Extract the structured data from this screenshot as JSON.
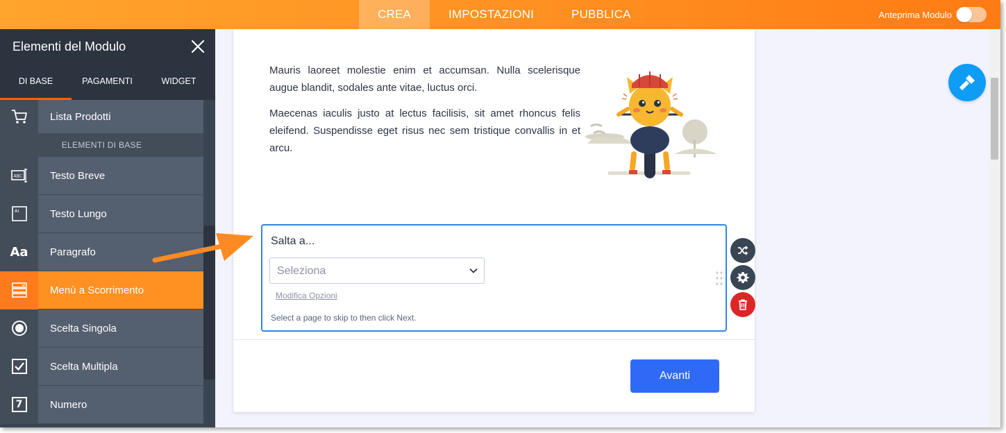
{
  "topbar": {
    "tabs": [
      {
        "label": "CREA",
        "active": true
      },
      {
        "label": "IMPOSTAZIONI",
        "active": false
      },
      {
        "label": "PUBBLICA",
        "active": false
      }
    ],
    "preview_label": "Anteprima Modulo",
    "preview_on": false
  },
  "sidebar": {
    "title": "Elementi del Modulo",
    "tabs": [
      {
        "label": "DI BASE",
        "active": true
      },
      {
        "label": "PAGAMENTI",
        "active": false
      },
      {
        "label": "WIDGET",
        "active": false
      }
    ],
    "top_item": {
      "label": "Lista Prodotti",
      "icon": "cart-icon"
    },
    "section_label": "ELEMENTI DI BASE",
    "items": [
      {
        "label": "Testo Breve",
        "icon": "short-text-icon"
      },
      {
        "label": "Testo Lungo",
        "icon": "long-text-icon"
      },
      {
        "label": "Paragrafo",
        "icon": "paragraph-icon",
        "glyph": "Aa"
      },
      {
        "label": "Menù a Scorrimento",
        "icon": "dropdown-icon",
        "active": true
      },
      {
        "label": "Scelta Singola",
        "icon": "radio-icon"
      },
      {
        "label": "Scelta Multipla",
        "icon": "checkbox-icon"
      },
      {
        "label": "Numero",
        "icon": "number-icon",
        "glyph": "7"
      }
    ]
  },
  "form": {
    "paragraph1": "Mauris laoreet molestie enim et accumsan. Nulla scelerisque augue blandit, sodales ante vitae, luctus orci.",
    "paragraph2": "Maecenas iaculis justo at lectus facilisis, sit amet rhoncus felis eleifend. Suspendisse eget risus nec sem tristique convallis in et arcu.",
    "field": {
      "label": "Salta a...",
      "placeholder": "Seleziona",
      "edit_options": "Modifica Opzioni",
      "sublabel": "Select a page to skip to then click Next."
    },
    "next_button": "Avanti"
  },
  "colors": {
    "accent_orange": "#ff9123",
    "field_border": "#2e86de",
    "next_button": "#2f6af6",
    "delete": "#dc2626",
    "paint_button": "#0f9cf5",
    "pointer_arrow": "#ff8a24"
  }
}
